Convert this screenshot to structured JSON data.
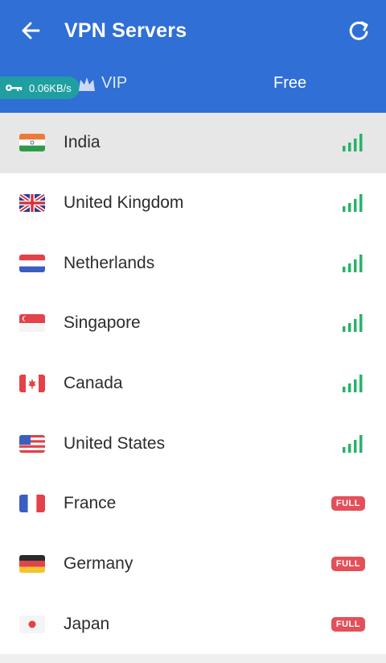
{
  "header": {
    "title": "VPN Servers",
    "back_icon": "arrow-left-icon",
    "refresh_icon": "refresh-icon",
    "background": "#2f6fd6"
  },
  "speed_badge": {
    "text": "0.06KB/s",
    "icon": "key-icon"
  },
  "tabs": [
    {
      "label": "VIP",
      "icon": "crown-icon"
    },
    {
      "label": "Free",
      "active": true
    }
  ],
  "servers": [
    {
      "name": "India",
      "flag": "india",
      "status": "signal",
      "selected": true
    },
    {
      "name": "United Kingdom",
      "flag": "uk",
      "status": "signal"
    },
    {
      "name": "Netherlands",
      "flag": "netherlands",
      "status": "signal"
    },
    {
      "name": "Singapore",
      "flag": "singapore",
      "status": "signal"
    },
    {
      "name": "Canada",
      "flag": "canada",
      "status": "signal"
    },
    {
      "name": "United States",
      "flag": "usa",
      "status": "signal"
    },
    {
      "name": "France",
      "flag": "france",
      "status": "full"
    },
    {
      "name": "Germany",
      "flag": "germany",
      "status": "full"
    },
    {
      "name": "Japan",
      "flag": "japan",
      "status": "full"
    }
  ],
  "full_label": "FULL",
  "colors": {
    "signal": "#27b36a",
    "full": "#e3505a"
  }
}
